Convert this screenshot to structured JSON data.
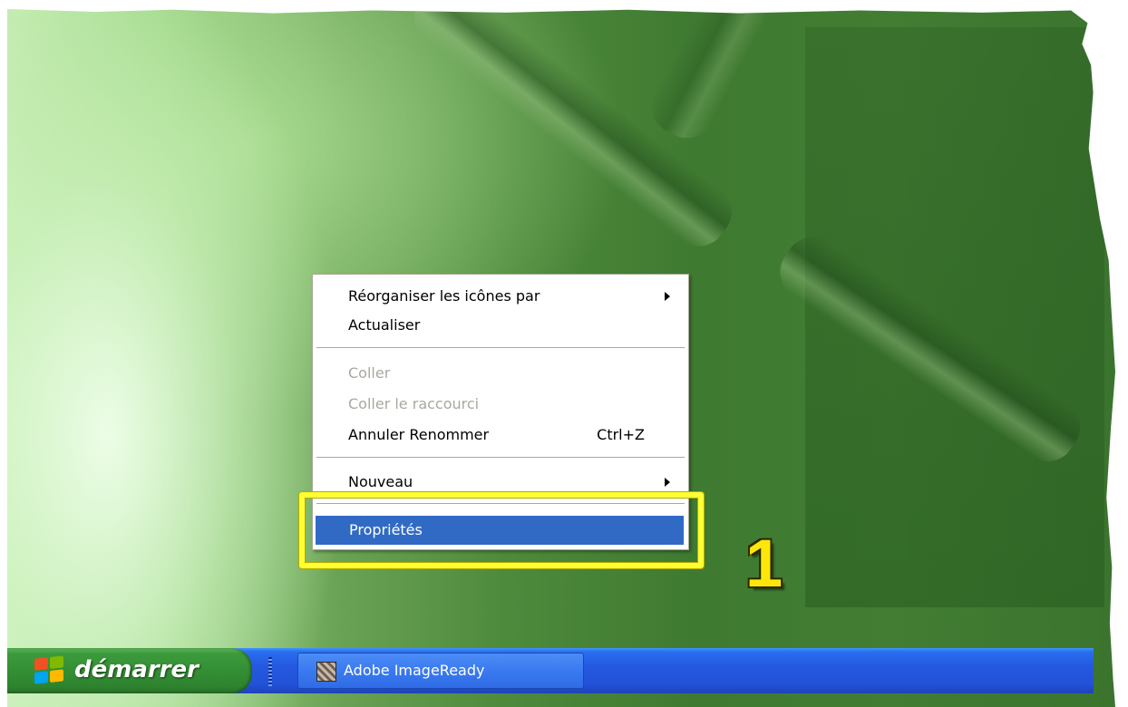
{
  "context_menu": {
    "items": [
      {
        "label": "Réorganiser les icônes par",
        "submenu": true
      },
      {
        "label": "Actualiser"
      },
      {
        "label": "Coller",
        "disabled": true
      },
      {
        "label": "Coller le raccourci",
        "disabled": true
      },
      {
        "label": "Annuler Renommer",
        "shortcut": "Ctrl+Z"
      },
      {
        "label": "Nouveau",
        "submenu": true
      },
      {
        "label": "Propriétés",
        "selected": true
      }
    ]
  },
  "annotation": {
    "number": "1",
    "color": "#ffff33"
  },
  "taskbar": {
    "start_label": "démarrer",
    "tasks": [
      {
        "label": "Adobe ImageReady",
        "icon": "imageready-icon"
      }
    ]
  },
  "colors": {
    "selection": "#316ac5",
    "taskbar": "#2458e0",
    "start_button": "#348f34"
  }
}
